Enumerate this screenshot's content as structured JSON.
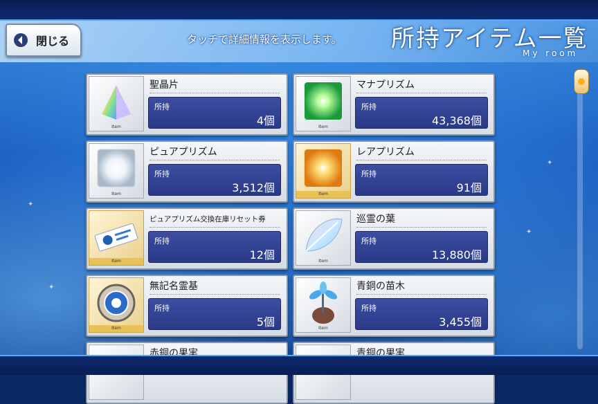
{
  "header": {
    "close_label": "閉じる",
    "hint": "タッチで詳細情報を表示します。",
    "title": "所持アイテム一覧",
    "subtitle": "My room"
  },
  "items": [
    {
      "name": "聖晶片",
      "qty_label": "所持",
      "qty": "4個",
      "tag": "Item",
      "icon": "quartz-fragment-icon"
    },
    {
      "name": "マナプリズム",
      "qty_label": "所持",
      "qty": "43,368個",
      "tag": "Item",
      "icon": "mana-prism-icon"
    },
    {
      "name": "ピュアプリズム",
      "qty_label": "所持",
      "qty": "3,512個",
      "tag": "Item",
      "icon": "pure-prism-icon"
    },
    {
      "name": "レアプリズム",
      "qty_label": "所持",
      "qty": "91個",
      "tag": "Item",
      "icon": "rare-prism-icon"
    },
    {
      "name": "ピュアプリズム交換在庫リセット券",
      "qty_label": "所持",
      "qty": "12個",
      "tag": "Item",
      "icon": "reset-ticket-icon"
    },
    {
      "name": "巡霊の葉",
      "qty_label": "所持",
      "qty": "13,880個",
      "tag": "Item",
      "icon": "spirit-leaf-icon"
    },
    {
      "name": "無記名霊基",
      "qty_label": "所持",
      "qty": "5個",
      "tag": "Item",
      "icon": "unregistered-spirit-origin-icon"
    },
    {
      "name": "青銅の苗木",
      "qty_label": "所持",
      "qty": "3,455個",
      "tag": "Item",
      "icon": "bronze-sapling-icon"
    },
    {
      "name": "赤銅の果実",
      "tag": "Item",
      "icon": "copper-fruit-icon"
    },
    {
      "name": "青銅の果実",
      "tag": "Item",
      "icon": "bronze-fruit-icon"
    }
  ]
}
